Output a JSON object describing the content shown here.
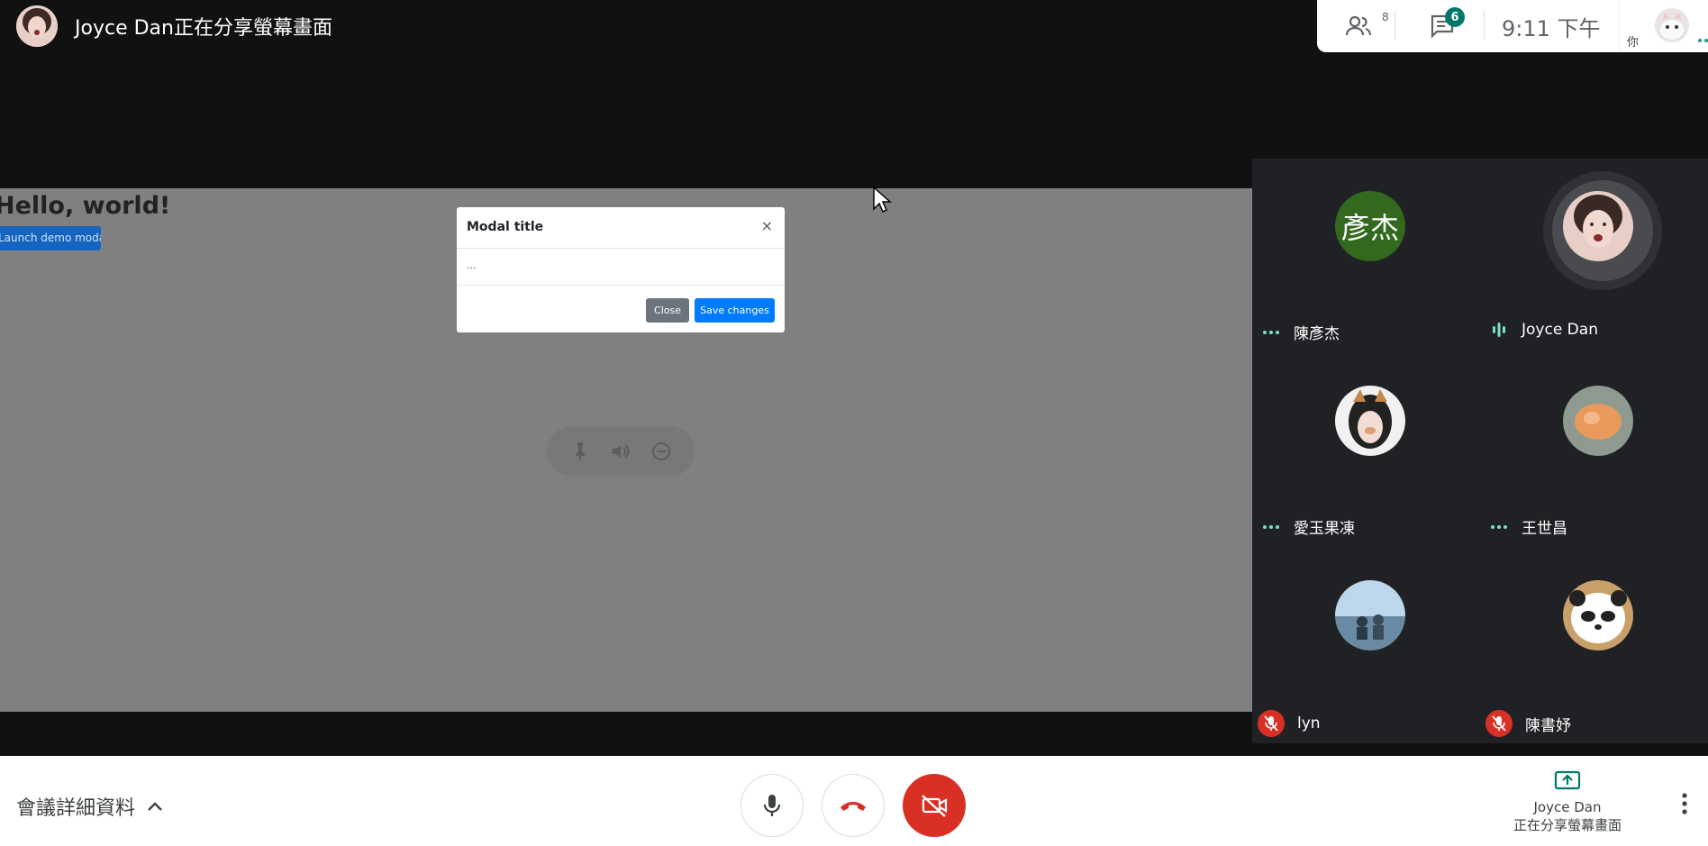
{
  "header": {
    "presenter_title": "Joyce Dan正在分享螢幕畫面"
  },
  "topbar": {
    "people_count": "8",
    "chat_badge": "6",
    "time": "9:11 下午",
    "self_label": "你"
  },
  "shared_screen": {
    "heading": "Hello, world!",
    "launch_button": "Launch demo modal",
    "modal": {
      "title": "Modal title",
      "close_x": "×",
      "body": "...",
      "close_button": "Close",
      "save_button": "Save changes"
    }
  },
  "participants": [
    {
      "name": "陳彥杰",
      "initials": "彥杰",
      "status": "dots"
    },
    {
      "name": "Joyce Dan",
      "status": "speaking"
    },
    {
      "name": "愛玉果凍",
      "status": "dots"
    },
    {
      "name": "王世昌",
      "status": "dots"
    },
    {
      "name": "lyn",
      "status": "muted"
    },
    {
      "name": "陳書妤",
      "status": "muted"
    }
  ],
  "bottombar": {
    "meeting_details": "會議詳細資料",
    "presenting_name": "Joyce Dan",
    "presenting_label": "正在分享螢幕畫面"
  },
  "colors": {
    "accent_green": "#00796b",
    "danger_red": "#d93025",
    "primary_blue": "#007bff",
    "panel_bg": "#202124",
    "initials_avatar": "#33691e"
  },
  "icons": [
    "people-icon",
    "chat-icon",
    "mic-icon",
    "hangup-icon",
    "camera-off-icon",
    "present-icon",
    "more-vert-icon",
    "chevron-up-icon",
    "pin-icon",
    "volume-icon",
    "remove-icon",
    "mic-off-icon",
    "audio-wave-icon"
  ]
}
